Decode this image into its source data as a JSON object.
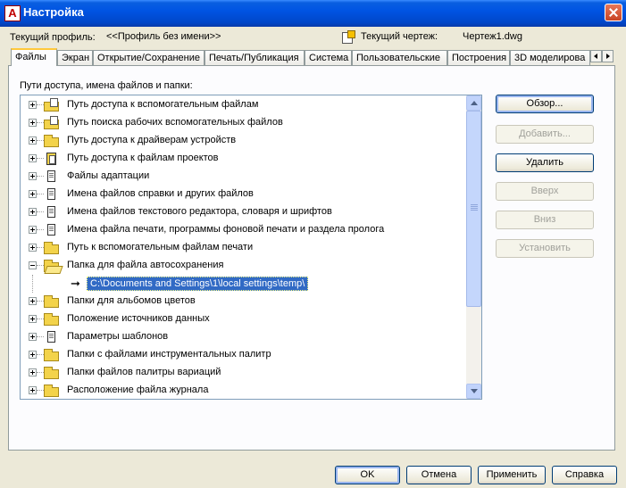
{
  "window": {
    "title": "Настройка",
    "app_icon_letter": "A"
  },
  "profile": {
    "label": "Текущий профиль:",
    "value": "<<Профиль без имени>>"
  },
  "drawing": {
    "label": "Текущий чертеж:",
    "value": "Чертеж1.dwg"
  },
  "tabs": [
    {
      "label": "Файлы",
      "active": true
    },
    {
      "label": "Экран"
    },
    {
      "label": "Открытие/Сохранение"
    },
    {
      "label": "Печать/Публикация"
    },
    {
      "label": "Система"
    },
    {
      "label": "Пользовательские"
    },
    {
      "label": "Построения"
    },
    {
      "label": "3D моделирова"
    }
  ],
  "tree": {
    "label": "Пути доступа, имена файлов и папки:",
    "items": [
      {
        "label": "Путь доступа к вспомогательным файлам",
        "icon": "folder-sheets-icon"
      },
      {
        "label": "Путь поиска рабочих вспомогательных файлов",
        "icon": "folder-sheets-icon"
      },
      {
        "label": "Путь доступа к драйверам устройств",
        "icon": "folder-icon"
      },
      {
        "label": "Путь доступа к файлам проектов",
        "icon": "project-icon"
      },
      {
        "label": "Файлы адаптации",
        "icon": "document-icon"
      },
      {
        "label": "Имена файлов справки и других файлов",
        "icon": "document-icon"
      },
      {
        "label": "Имена файлов текстового редактора, словаря и шрифтов",
        "icon": "document-icon"
      },
      {
        "label": "Имена файла печати, программы фоновой печати и раздела пролога",
        "icon": "document-icon"
      },
      {
        "label": "Путь к вспомогательным файлам печати",
        "icon": "folder-icon"
      },
      {
        "label": "Папка для файла автосохранения",
        "icon": "folder-open-icon",
        "expanded": true
      },
      {
        "label": "Папки для альбомов цветов",
        "icon": "folder-icon"
      },
      {
        "label": "Положение источников данных",
        "icon": "folder-icon"
      },
      {
        "label": "Параметры шаблонов",
        "icon": "document-icon"
      },
      {
        "label": "Папки с файлами инструментальных палитр",
        "icon": "folder-icon"
      },
      {
        "label": "Папки файлов палитры вариаций",
        "icon": "folder-icon"
      },
      {
        "label": "Расположение файла журнала",
        "icon": "folder-icon"
      }
    ],
    "selected_subitem": "C:\\Documents and Settings\\1\\local settings\\temp\\"
  },
  "side_buttons": {
    "browse": "Обзор...",
    "add": "Добавить...",
    "remove": "Удалить",
    "up": "Вверх",
    "down": "Вниз",
    "set": "Установить"
  },
  "footer_buttons": {
    "ok": "OK",
    "cancel": "Отмена",
    "apply": "Применить",
    "help": "Справка"
  }
}
